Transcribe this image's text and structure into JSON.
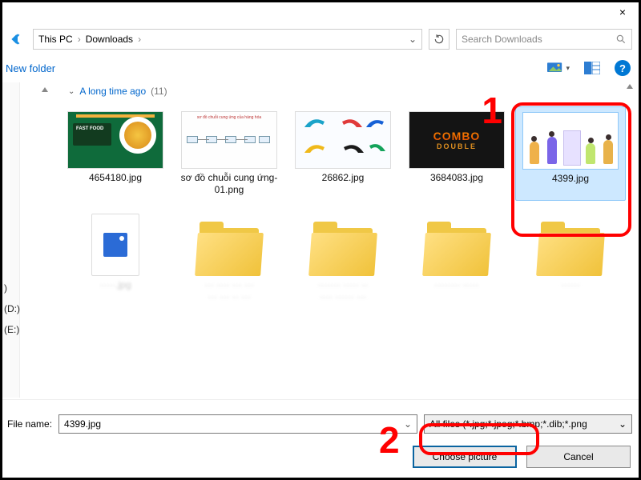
{
  "title": {
    "close": "×"
  },
  "breadcrumbs": {
    "item1": "This PC",
    "item2": "Downloads",
    "sep": "›"
  },
  "search": {
    "placeholder": "Search Downloads"
  },
  "cmd": {
    "newfolder": "New folder"
  },
  "group": {
    "label": "A long time ago",
    "count": "(11)"
  },
  "files": {
    "r1": [
      {
        "label": "4654180.jpg"
      },
      {
        "label": "sơ đồ chuỗi cung ứng-01.png"
      },
      {
        "label": "26862.jpg"
      },
      {
        "label": "3684083.jpg"
      },
      {
        "label": "4399.jpg"
      }
    ]
  },
  "sidebar": {
    "d": "(D:)",
    "e": "(E:)"
  },
  "bottom": {
    "fname_label": "File name:",
    "fname_value": "4399.jpg",
    "type_value": "All files (*.jpg;*.jpeg;*.bmp;*.dib;*.png",
    "choose": "Choose picture",
    "cancel": "Cancel"
  },
  "annotations": {
    "one": "1",
    "two": "2"
  }
}
